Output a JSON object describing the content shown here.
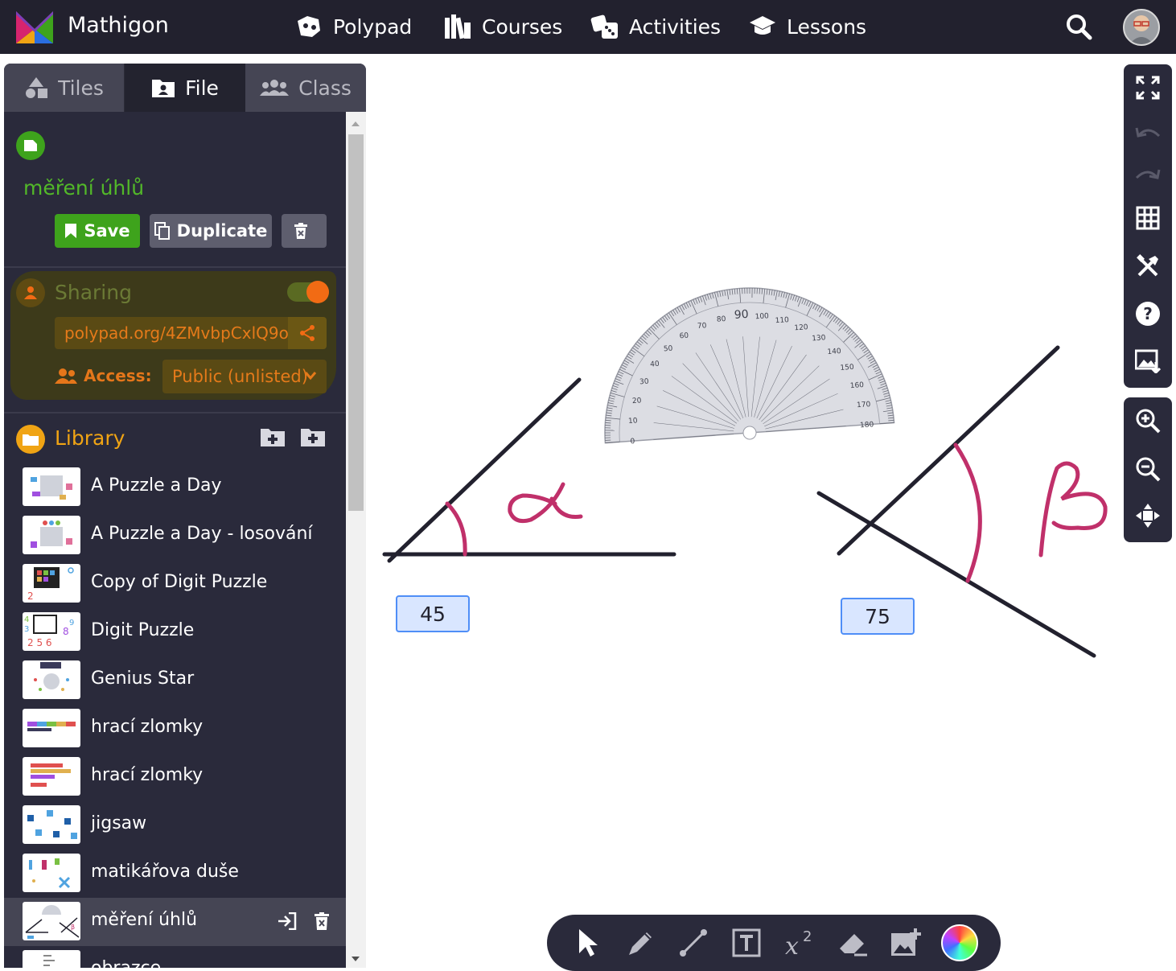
{
  "topbar": {
    "brand": "Mathigon",
    "nav": [
      {
        "label": "Polypad",
        "icon": "polypad-icon"
      },
      {
        "label": "Courses",
        "icon": "books-icon"
      },
      {
        "label": "Activities",
        "icon": "dice-icon"
      },
      {
        "label": "Lessons",
        "icon": "graduation-cap-icon"
      }
    ]
  },
  "sidebar": {
    "tabs": [
      {
        "label": "Tiles",
        "icon": "shapes-icon"
      },
      {
        "label": "File",
        "icon": "file-user-icon"
      },
      {
        "label": "Class",
        "icon": "users-icon"
      }
    ],
    "file": {
      "title": "měření úhlů",
      "save_label": "Save",
      "duplicate_label": "Duplicate"
    },
    "sharing": {
      "title": "Sharing",
      "enabled": true,
      "link": "polypad.org/4ZMvbpCxlQ9o",
      "access_label": "Access:",
      "access_value": "Public (unlisted)"
    },
    "library": {
      "title": "Library",
      "items": [
        {
          "label": "A Puzzle a Day"
        },
        {
          "label": "A Puzzle a Day - losování"
        },
        {
          "label": "Copy of Digit Puzzle"
        },
        {
          "label": "Digit Puzzle"
        },
        {
          "label": "Genius Star"
        },
        {
          "label": "hrací zlomky"
        },
        {
          "label": "hrací zlomky"
        },
        {
          "label": "jigsaw"
        },
        {
          "label": "matikářova  duše"
        },
        {
          "label": "měření úhlů",
          "active": true
        },
        {
          "label": "obrazce"
        }
      ]
    }
  },
  "canvas": {
    "answer_boxes": [
      {
        "value": "45"
      },
      {
        "value": "75"
      }
    ],
    "protractor_labels": [
      "0",
      "10",
      "20",
      "30",
      "40",
      "50",
      "60",
      "70",
      "80",
      "90",
      "100",
      "110",
      "120",
      "130",
      "140",
      "150",
      "160",
      "170",
      "180"
    ]
  },
  "colors": {
    "topbar": "#22212e",
    "sidebar": "#2a2a3b",
    "green": "#3ea31c",
    "orange": "#f26b14",
    "library": "#f0a414",
    "ink": "#c0306a",
    "line": "#22212e"
  }
}
